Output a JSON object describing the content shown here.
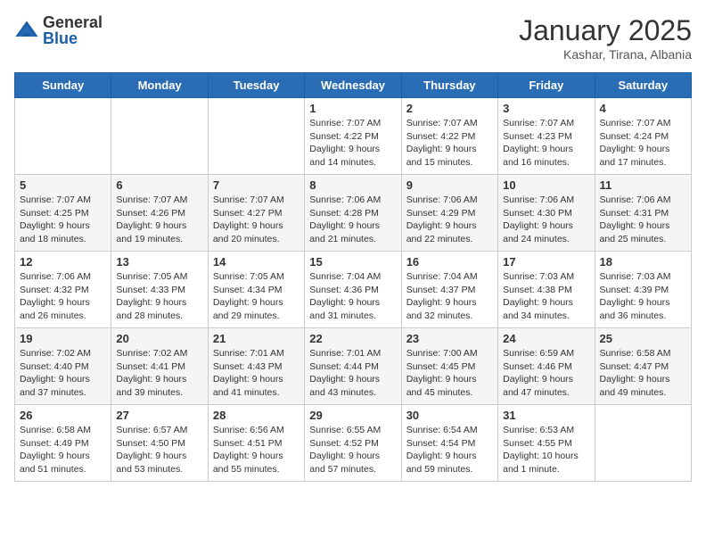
{
  "header": {
    "logo_general": "General",
    "logo_blue": "Blue",
    "month_title": "January 2025",
    "location": "Kashar, Tirana, Albania"
  },
  "days_of_week": [
    "Sunday",
    "Monday",
    "Tuesday",
    "Wednesday",
    "Thursday",
    "Friday",
    "Saturday"
  ],
  "weeks": [
    {
      "style": "row-white",
      "days": [
        {
          "num": "",
          "info": ""
        },
        {
          "num": "",
          "info": ""
        },
        {
          "num": "",
          "info": ""
        },
        {
          "num": "1",
          "info": "Sunrise: 7:07 AM\nSunset: 4:22 PM\nDaylight: 9 hours\nand 14 minutes."
        },
        {
          "num": "2",
          "info": "Sunrise: 7:07 AM\nSunset: 4:22 PM\nDaylight: 9 hours\nand 15 minutes."
        },
        {
          "num": "3",
          "info": "Sunrise: 7:07 AM\nSunset: 4:23 PM\nDaylight: 9 hours\nand 16 minutes."
        },
        {
          "num": "4",
          "info": "Sunrise: 7:07 AM\nSunset: 4:24 PM\nDaylight: 9 hours\nand 17 minutes."
        }
      ]
    },
    {
      "style": "row-gray",
      "days": [
        {
          "num": "5",
          "info": "Sunrise: 7:07 AM\nSunset: 4:25 PM\nDaylight: 9 hours\nand 18 minutes."
        },
        {
          "num": "6",
          "info": "Sunrise: 7:07 AM\nSunset: 4:26 PM\nDaylight: 9 hours\nand 19 minutes."
        },
        {
          "num": "7",
          "info": "Sunrise: 7:07 AM\nSunset: 4:27 PM\nDaylight: 9 hours\nand 20 minutes."
        },
        {
          "num": "8",
          "info": "Sunrise: 7:06 AM\nSunset: 4:28 PM\nDaylight: 9 hours\nand 21 minutes."
        },
        {
          "num": "9",
          "info": "Sunrise: 7:06 AM\nSunset: 4:29 PM\nDaylight: 9 hours\nand 22 minutes."
        },
        {
          "num": "10",
          "info": "Sunrise: 7:06 AM\nSunset: 4:30 PM\nDaylight: 9 hours\nand 24 minutes."
        },
        {
          "num": "11",
          "info": "Sunrise: 7:06 AM\nSunset: 4:31 PM\nDaylight: 9 hours\nand 25 minutes."
        }
      ]
    },
    {
      "style": "row-white",
      "days": [
        {
          "num": "12",
          "info": "Sunrise: 7:06 AM\nSunset: 4:32 PM\nDaylight: 9 hours\nand 26 minutes."
        },
        {
          "num": "13",
          "info": "Sunrise: 7:05 AM\nSunset: 4:33 PM\nDaylight: 9 hours\nand 28 minutes."
        },
        {
          "num": "14",
          "info": "Sunrise: 7:05 AM\nSunset: 4:34 PM\nDaylight: 9 hours\nand 29 minutes."
        },
        {
          "num": "15",
          "info": "Sunrise: 7:04 AM\nSunset: 4:36 PM\nDaylight: 9 hours\nand 31 minutes."
        },
        {
          "num": "16",
          "info": "Sunrise: 7:04 AM\nSunset: 4:37 PM\nDaylight: 9 hours\nand 32 minutes."
        },
        {
          "num": "17",
          "info": "Sunrise: 7:03 AM\nSunset: 4:38 PM\nDaylight: 9 hours\nand 34 minutes."
        },
        {
          "num": "18",
          "info": "Sunrise: 7:03 AM\nSunset: 4:39 PM\nDaylight: 9 hours\nand 36 minutes."
        }
      ]
    },
    {
      "style": "row-gray",
      "days": [
        {
          "num": "19",
          "info": "Sunrise: 7:02 AM\nSunset: 4:40 PM\nDaylight: 9 hours\nand 37 minutes."
        },
        {
          "num": "20",
          "info": "Sunrise: 7:02 AM\nSunset: 4:41 PM\nDaylight: 9 hours\nand 39 minutes."
        },
        {
          "num": "21",
          "info": "Sunrise: 7:01 AM\nSunset: 4:43 PM\nDaylight: 9 hours\nand 41 minutes."
        },
        {
          "num": "22",
          "info": "Sunrise: 7:01 AM\nSunset: 4:44 PM\nDaylight: 9 hours\nand 43 minutes."
        },
        {
          "num": "23",
          "info": "Sunrise: 7:00 AM\nSunset: 4:45 PM\nDaylight: 9 hours\nand 45 minutes."
        },
        {
          "num": "24",
          "info": "Sunrise: 6:59 AM\nSunset: 4:46 PM\nDaylight: 9 hours\nand 47 minutes."
        },
        {
          "num": "25",
          "info": "Sunrise: 6:58 AM\nSunset: 4:47 PM\nDaylight: 9 hours\nand 49 minutes."
        }
      ]
    },
    {
      "style": "row-white",
      "days": [
        {
          "num": "26",
          "info": "Sunrise: 6:58 AM\nSunset: 4:49 PM\nDaylight: 9 hours\nand 51 minutes."
        },
        {
          "num": "27",
          "info": "Sunrise: 6:57 AM\nSunset: 4:50 PM\nDaylight: 9 hours\nand 53 minutes."
        },
        {
          "num": "28",
          "info": "Sunrise: 6:56 AM\nSunset: 4:51 PM\nDaylight: 9 hours\nand 55 minutes."
        },
        {
          "num": "29",
          "info": "Sunrise: 6:55 AM\nSunset: 4:52 PM\nDaylight: 9 hours\nand 57 minutes."
        },
        {
          "num": "30",
          "info": "Sunrise: 6:54 AM\nSunset: 4:54 PM\nDaylight: 9 hours\nand 59 minutes."
        },
        {
          "num": "31",
          "info": "Sunrise: 6:53 AM\nSunset: 4:55 PM\nDaylight: 10 hours\nand 1 minute."
        },
        {
          "num": "",
          "info": ""
        }
      ]
    }
  ]
}
